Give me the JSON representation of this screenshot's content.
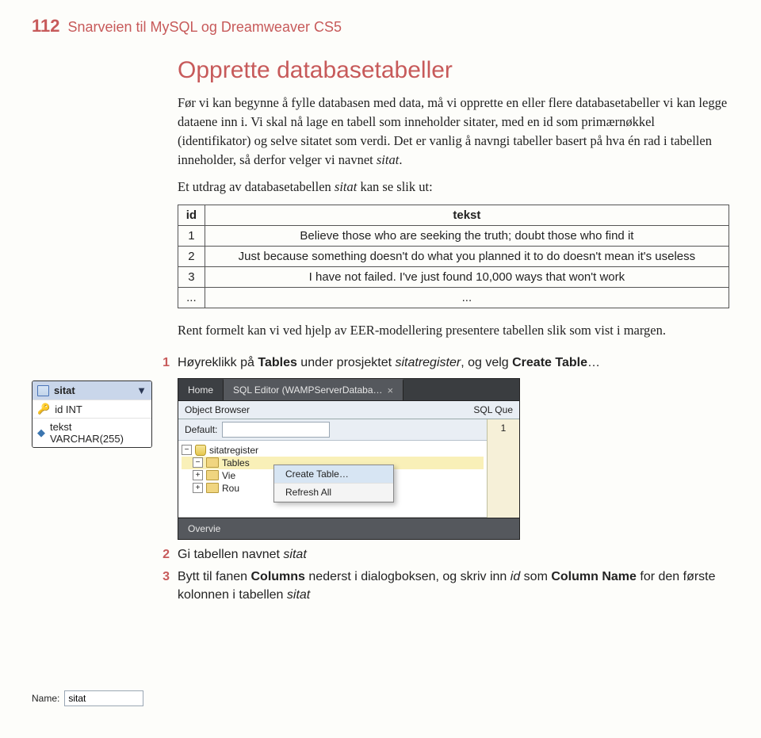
{
  "header": {
    "page_number": "112",
    "running_head": "Snarveien til MySQL og Dreamweaver CS5"
  },
  "section_title": "Opprette databasetabeller",
  "intro": {
    "p1": "Før vi kan begynne å fylle databasen med data, må vi opprette en eller flere databasetabeller vi kan legge dataene inn i. Vi skal nå lage en tabell som inneholder sitater, med en id som primærnøkkel (identifikator) og selve sitatet som verdi. Det er vanlig å navngi tabeller basert på hva én rad i tabellen inneholder, så derfor velger vi navnet ",
    "p1_term": "sitat",
    "p1_tail": "."
  },
  "extract_line_a": "Et utdrag av databasetabellen ",
  "extract_line_term": "sitat",
  "extract_line_b": " kan se slik ut:",
  "table": {
    "headers": {
      "id": "id",
      "tekst": "tekst"
    },
    "rows": [
      {
        "id": "1",
        "tekst": "Believe those who are seeking the truth; doubt those who find it"
      },
      {
        "id": "2",
        "tekst": "Just because something doesn't do what you planned it to do doesn't mean it's useless"
      },
      {
        "id": "3",
        "tekst": "I have not failed. I've just found 10,000 ways that won't work"
      },
      {
        "id": "...",
        "tekst": "..."
      }
    ]
  },
  "eer": {
    "title": "sitat",
    "row1": "id INT",
    "row2": "tekst VARCHAR(255)"
  },
  "after_table_para": "Rent formelt kan vi ved hjelp av EER-modellering presentere tabellen slik som vist i margen.",
  "step1_a": "Høyreklikk på ",
  "step1_b": "Tables",
  "step1_c": " under prosjektet ",
  "step1_d": "sitatregister",
  "step1_e": ", og velg ",
  "step1_f": "Create Table",
  "step1_g": "…",
  "workbench": {
    "tab_home": "Home",
    "tab_sql": "SQL Editor (WAMPServerDataba…",
    "panel_left": "Object Browser",
    "panel_right": "SQL Que",
    "default_label": "Default:",
    "right_num": "1",
    "db_name": "sitatregister",
    "folder_tables": "Tables",
    "folder_views": "Vie",
    "folder_routines": "Rou",
    "menu_create": "Create Table…",
    "menu_refresh": "Refresh All",
    "overview": "Overvie"
  },
  "name_mock": {
    "label": "Name:",
    "value": "sitat"
  },
  "step2_a": "Gi tabellen navnet ",
  "step2_b": "sitat",
  "step3_a": "Bytt til fanen ",
  "step3_b": "Columns",
  "step3_c": " nederst i dialogboksen, og skriv inn ",
  "step3_d": "id",
  "step3_e": " som ",
  "step3_f": "Column Name",
  "step3_g": " for den første kolonnen i tabellen ",
  "step3_h": "sitat",
  "nums": {
    "n1": "1",
    "n2": "2",
    "n3": "3"
  }
}
